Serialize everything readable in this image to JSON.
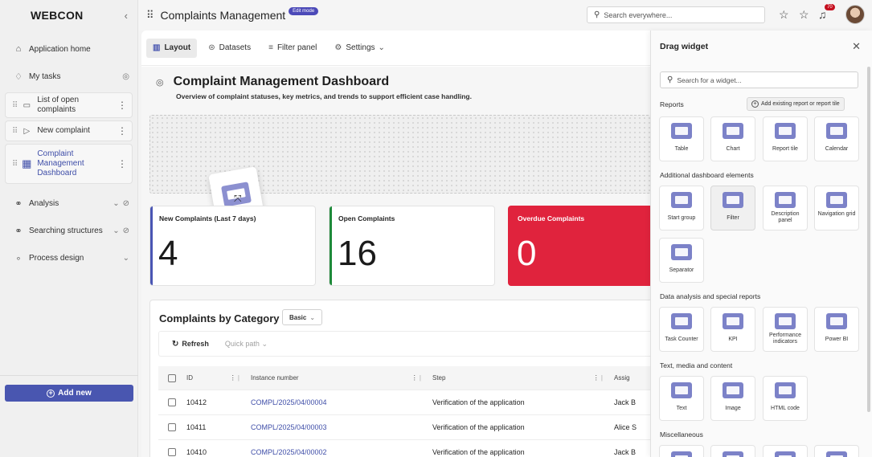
{
  "sidebar": {
    "logo": "WEBCON",
    "collapse_icon": "chevron-left-icon",
    "app_home": "Application home",
    "my_tasks": "My tasks",
    "items": [
      {
        "label": "List of open complaints"
      },
      {
        "label": "New complaint"
      },
      {
        "label": "Complaint Management Dashboard"
      }
    ],
    "analysis": "Analysis",
    "searching": "Searching structures",
    "process_design": "Process design",
    "add_new": "Add new"
  },
  "topbar": {
    "app_title": "Complaints Management",
    "edit_badge": "Edit mode",
    "search_placeholder": "Search everywhere...",
    "notification_count": "70"
  },
  "tabs": {
    "layout": "Layout",
    "datasets": "Datasets",
    "filter_panel": "Filter panel",
    "settings": "Settings"
  },
  "dashboard": {
    "title": "Complaint Management Dashboard",
    "description": "Overview of complaint statuses, key metrics, and trends to support efficient case handling."
  },
  "kpis": [
    {
      "title": "New Complaints (Last 7 days)",
      "value": "4",
      "color": "#4a56b4"
    },
    {
      "title": "Open Complaints",
      "value": "16",
      "color": "#1e8a3a"
    },
    {
      "title": "Overdue Complaints",
      "value": "0",
      "color": "#e0233d"
    }
  ],
  "report": {
    "title": "Complaints by Category",
    "mode": "Basic",
    "refresh": "Refresh",
    "quick_path": "Quick path",
    "columns": [
      "ID",
      "Instance number",
      "Step",
      "Assig"
    ],
    "rows": [
      {
        "id": "10412",
        "instance": "COMPL/2025/04/00004",
        "step": "Verification of the application",
        "assignee": "Jack B"
      },
      {
        "id": "10411",
        "instance": "COMPL/2025/04/00003",
        "step": "Verification of the application",
        "assignee": "Alice S"
      },
      {
        "id": "10410",
        "instance": "COMPL/2025/04/00002",
        "step": "Verification of the application",
        "assignee": "Jack B"
      }
    ]
  },
  "panel": {
    "title": "Drag widget",
    "search_placeholder": "Search for a widget...",
    "sections": {
      "reports": "Reports",
      "additional": "Additional dashboard elements",
      "data_analysis": "Data analysis and special reports",
      "text_media": "Text, media and content",
      "misc": "Miscellaneous"
    },
    "add_existing": "Add existing report or report tile",
    "reports": [
      "Table",
      "Chart",
      "Report tile",
      "Calendar"
    ],
    "additional": [
      "Start group",
      "Filter",
      "Description panel",
      "Navigation grid",
      "Separator"
    ],
    "data_analysis": [
      "Task Counter",
      "KPI",
      "Performance indicators",
      "Power BI"
    ],
    "text_media": [
      "Text",
      "Image",
      "HTML code"
    ]
  }
}
